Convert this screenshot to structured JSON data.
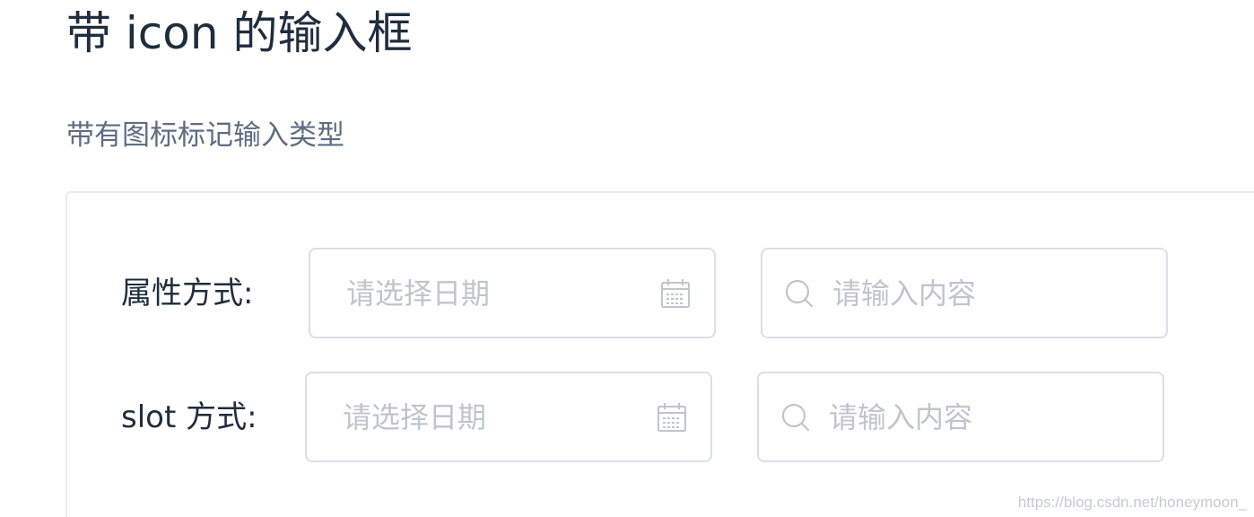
{
  "page": {
    "title": "带 icon 的输入框",
    "description": "带有图标标记输入类型"
  },
  "rows": [
    {
      "label": "属性方式:",
      "date_input": {
        "value": "",
        "placeholder": "请选择日期",
        "icon": "calendar-icon"
      },
      "search_input": {
        "value": "",
        "placeholder": "请输入内容",
        "icon": "search-icon"
      }
    },
    {
      "label": "slot 方式:",
      "date_input": {
        "value": "",
        "placeholder": "请选择日期",
        "icon": "calendar-icon"
      },
      "search_input": {
        "value": "",
        "placeholder": "请输入内容",
        "icon": "search-icon"
      }
    }
  ],
  "watermark": "https://blog.csdn.net/honeymoon_",
  "colors": {
    "title": "#1f2d3d",
    "description": "#5e6d82",
    "border": "#dcdfe6",
    "placeholder": "#c0c4cc",
    "icon": "#c0c4cc"
  }
}
